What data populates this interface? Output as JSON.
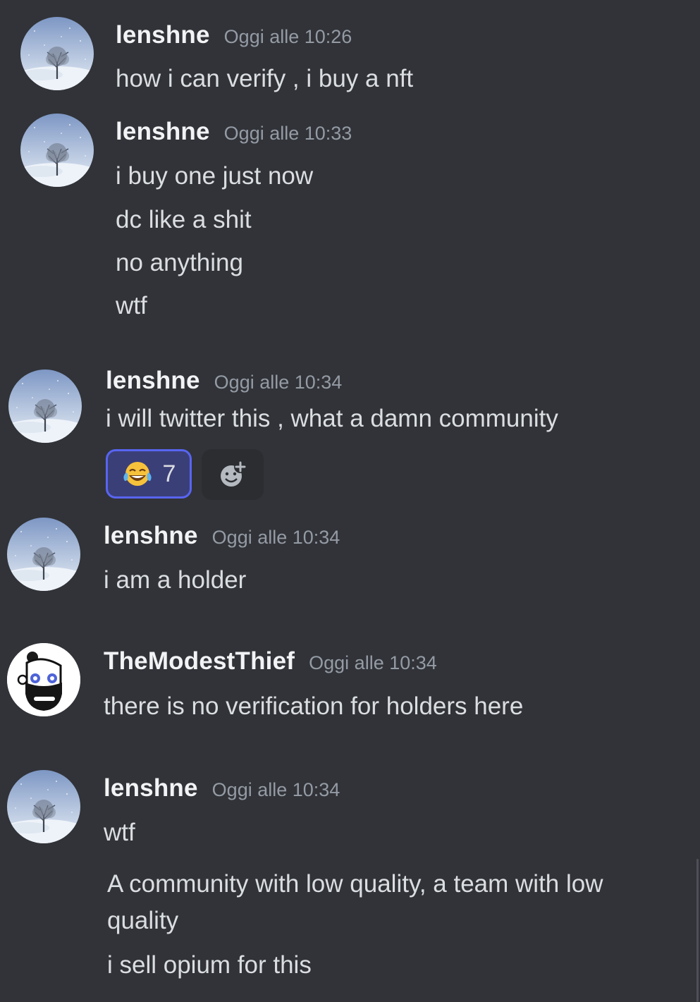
{
  "messages": [
    {
      "username": "lenshne",
      "timestamp": "Oggi alle 10:26",
      "lines": [
        "how i  can verify  ,  i buy a nft"
      ]
    },
    {
      "username": "lenshne",
      "timestamp": "Oggi alle 10:33",
      "lines": [
        "i  buy one just now",
        "dc like a shit",
        "no anything",
        "wtf"
      ]
    },
    {
      "username": "lenshne",
      "timestamp": "Oggi alle 10:34",
      "lines": [
        "i will twitter this , what a damn community"
      ],
      "reaction": {
        "emoji": "face-with-tears-of-joy",
        "count": "7"
      }
    },
    {
      "username": "lenshne",
      "timestamp": "Oggi alle 10:34",
      "lines": [
        "i  am a holder"
      ]
    },
    {
      "username": "TheModestThief",
      "timestamp": "Oggi alle 10:34",
      "lines": [
        "there is no verification for holders here"
      ]
    },
    {
      "username": "lenshne",
      "timestamp": "Oggi alle 10:34",
      "lines": [
        "wtf",
        "A community with low quality, a team with low quality",
        "i sell opium for this"
      ]
    }
  ],
  "colors": {
    "background": "#313338",
    "username": "#f2f3f5",
    "timestamp": "#949ba4",
    "text": "#dbdee1",
    "reaction_bg": "#3b3f78",
    "reaction_border": "#5865f2"
  },
  "icons": {
    "avatar_lenshne": "snowy-tree-avatar",
    "avatar_themodestthief": "bearded-man-avatar",
    "add_reaction": "add-reaction-icon"
  }
}
